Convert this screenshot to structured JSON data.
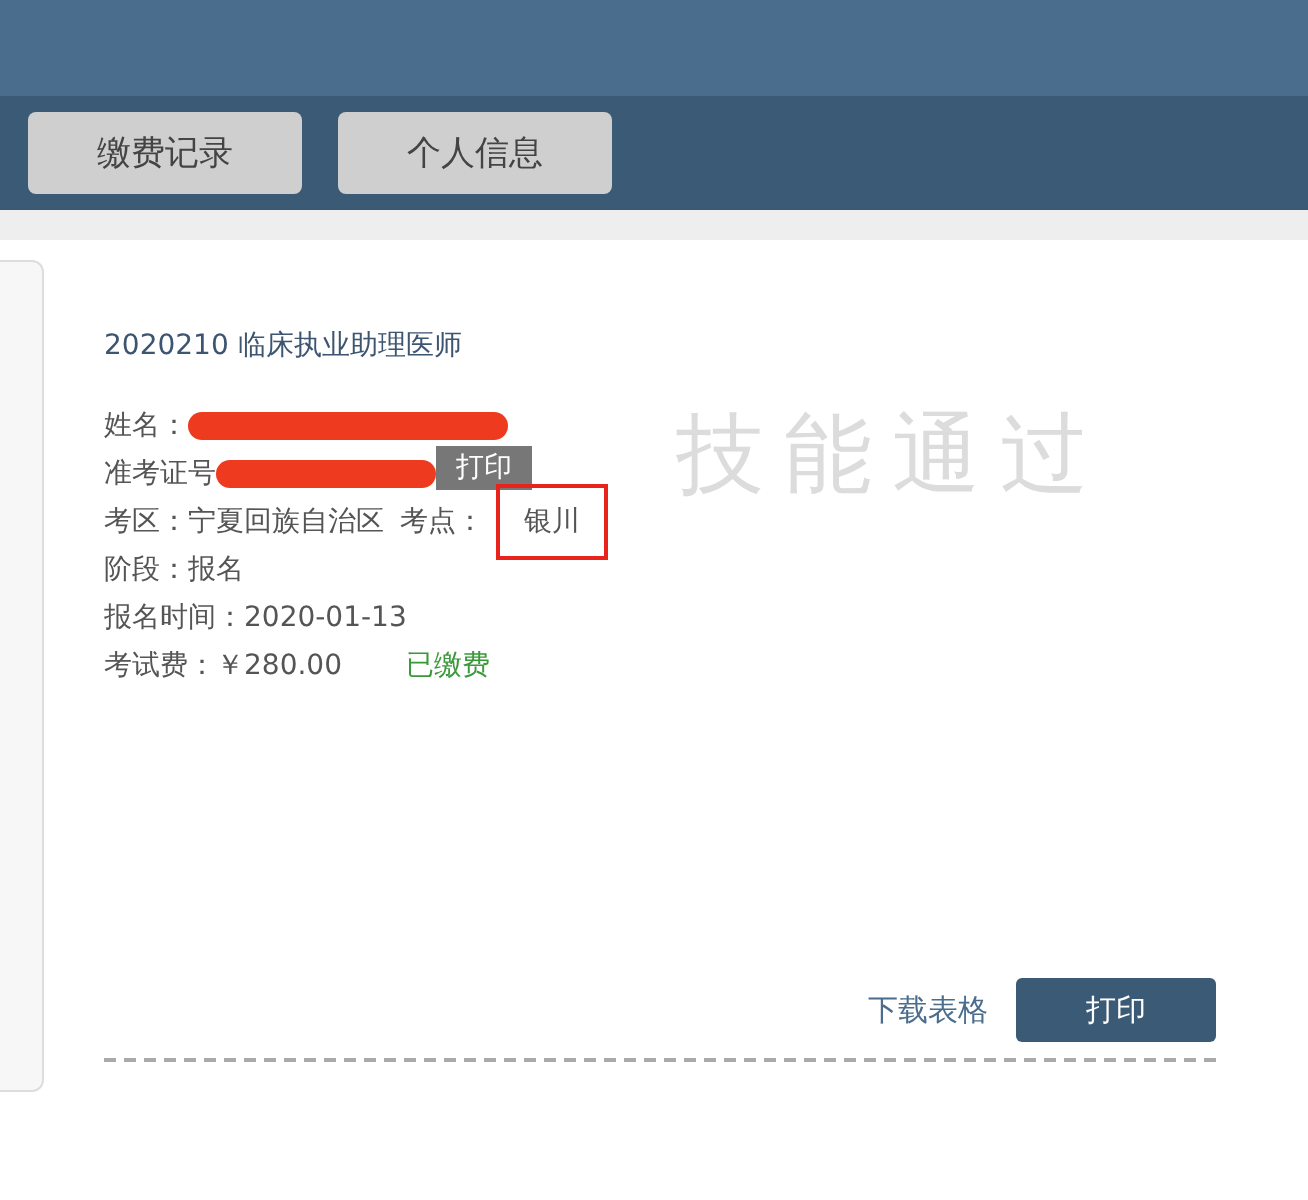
{
  "nav_buttons": [
    {
      "label": "缴费记录"
    },
    {
      "label": "个人信息"
    }
  ],
  "exam_title": "2020210 临床执业助理医师",
  "fields": [
    {
      "kind": "redacted",
      "label": "姓名："
    },
    {
      "kind": "redacted_button",
      "label": "准考证号",
      "button": "打印"
    },
    {
      "kind": "pair",
      "label": "考区：",
      "value": "宁夏回族自治区",
      "label_2": "考点：",
      "value_2": "银川",
      "highlighted": true
    },
    {
      "kind": "plain",
      "label": "阶段：",
      "value": "报名"
    },
    {
      "kind": "plain",
      "label": "报名时间：",
      "value": "2020-01-13"
    },
    {
      "kind": "fee",
      "label": "考试费：",
      "value": "￥280.00",
      "status": "已缴费",
      "paid": true
    }
  ],
  "stamp": "技能通过",
  "footer": {
    "link": "下载表格",
    "button": "打印"
  }
}
